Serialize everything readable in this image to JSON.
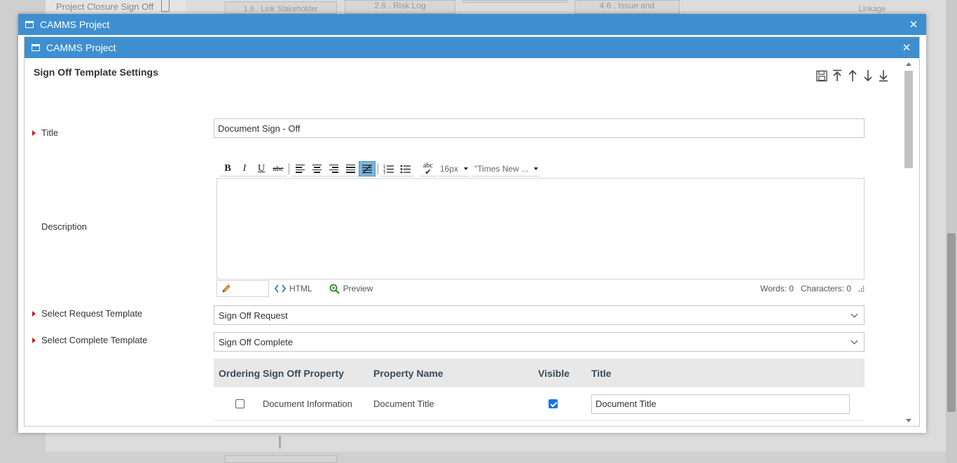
{
  "background": {
    "closure_label": "Project Closure Sign Off",
    "tiles": [
      "1.6 . Link Stakeholder",
      "2.6 . Risk Log",
      "4.6 . Issue and",
      "Linkage"
    ]
  },
  "outer_window": {
    "title": "CAMMS Project"
  },
  "inner_window": {
    "title": "CAMMS Project"
  },
  "form": {
    "heading": "Sign Off Template Settings",
    "title_label": "Title",
    "title_value": "Document Sign - Off",
    "description_label": "Description",
    "request_label": "Select Request Template",
    "request_value": "Sign Off Request",
    "complete_label": "Select Complete Template",
    "complete_value": "Sign Off Complete"
  },
  "editor": {
    "bold": "B",
    "italic": "I",
    "underline": "U",
    "strike": "abc",
    "spell": "abc",
    "font_size": "16px",
    "font_name": "\"Times New ...",
    "mode_html": "HTML",
    "mode_preview": "Preview",
    "words": "Words: 0",
    "characters": "Characters: 0"
  },
  "table": {
    "headers": [
      "Ordering",
      "Sign Off Property",
      "Property Name",
      "Visible",
      "Title"
    ],
    "rows": [
      {
        "property": "Document Information",
        "name": "Document Title",
        "visible": true,
        "title": "Document Title"
      }
    ]
  },
  "colors": {
    "titlebar": "#3f8fd0",
    "required": "#d21a1a",
    "active_tool": "#7ab8dc"
  }
}
